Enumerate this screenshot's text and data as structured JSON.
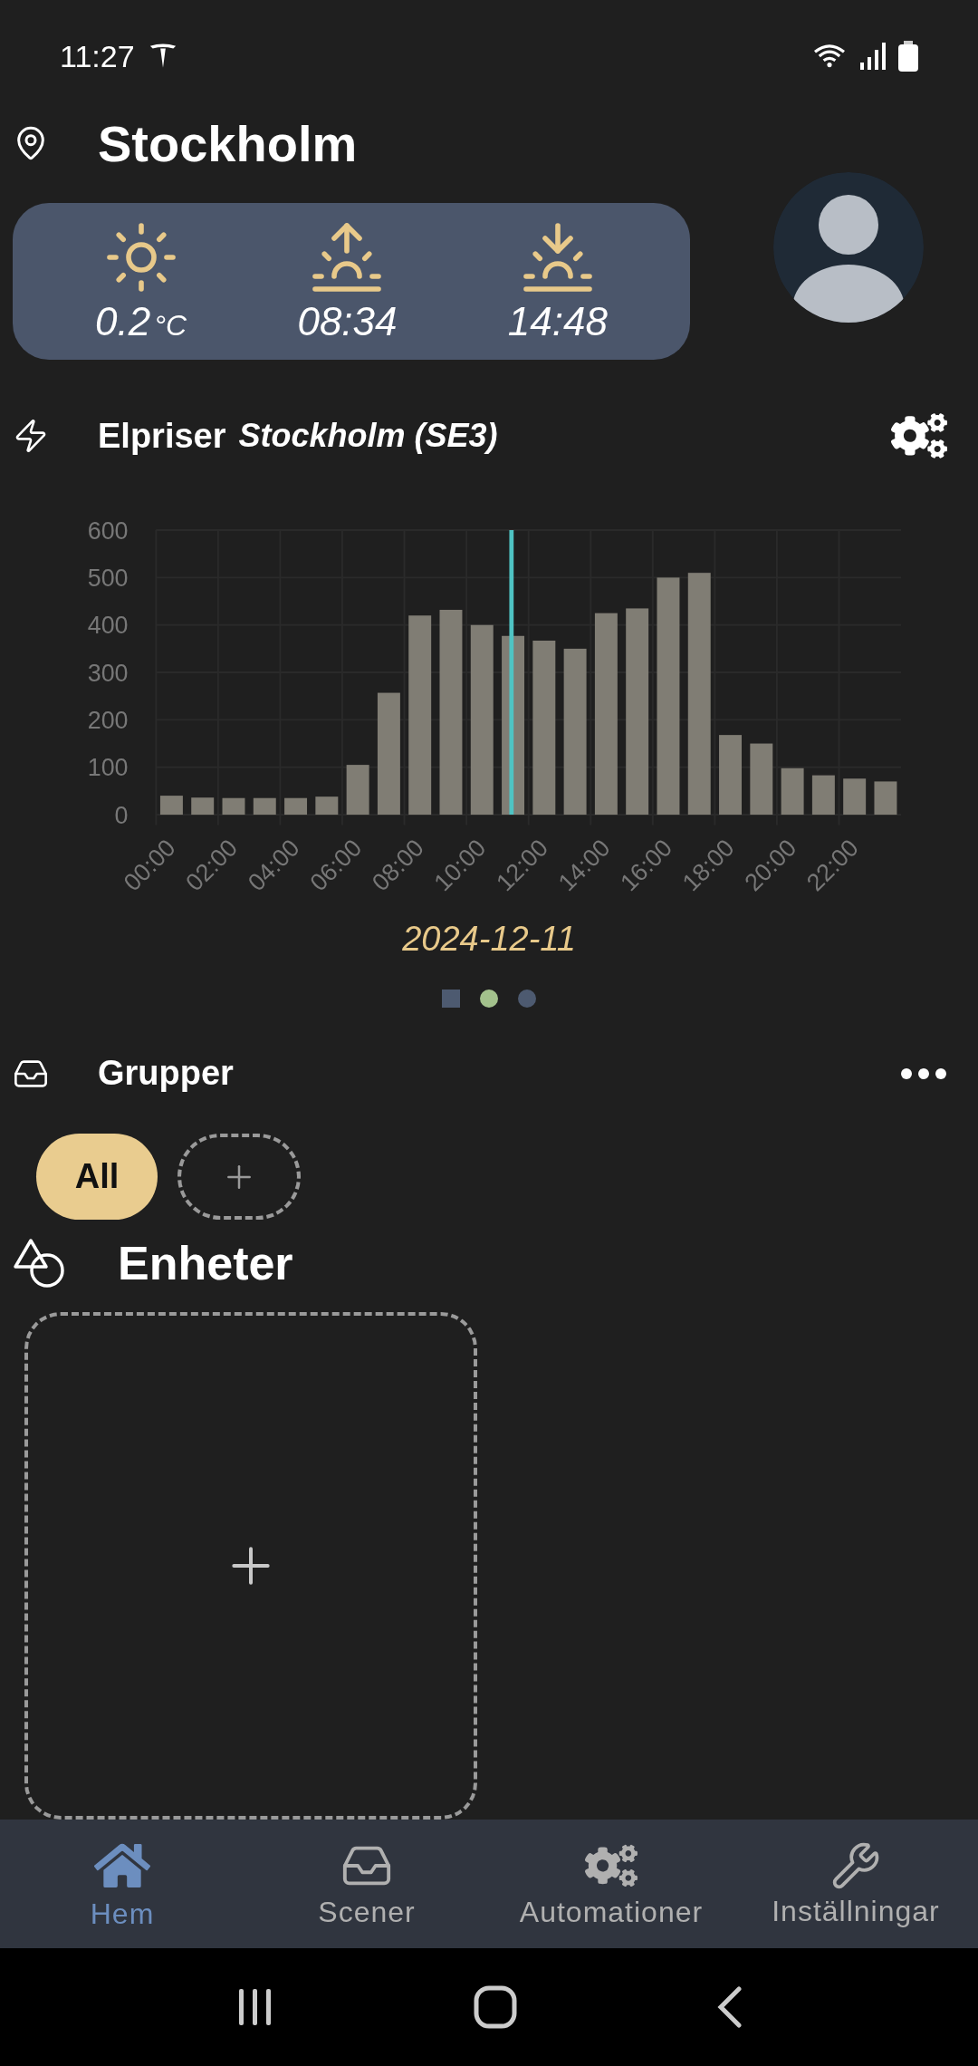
{
  "status_bar": {
    "time": "11:27"
  },
  "location": {
    "title": "Stockholm"
  },
  "weather": [
    {
      "kind": "temperature",
      "value": "0.2",
      "unit": "°C"
    },
    {
      "kind": "sunrise",
      "value": "08:34"
    },
    {
      "kind": "sunset",
      "value": "14:48"
    }
  ],
  "prices": {
    "title": "Elpriser",
    "region": "Stockholm (SE3)",
    "chart_data": {
      "type": "bar",
      "x": [
        0.5,
        1.5,
        2.5,
        3.5,
        4.5,
        5.5,
        6.5,
        7.5,
        8.5,
        9.5,
        10.5,
        11.5,
        12.5,
        13.5,
        14.5,
        15.5,
        16.5,
        17.5,
        18.5,
        19.5,
        20.5,
        21.5,
        22.5,
        23.5
      ],
      "xlim": [
        0,
        24
      ],
      "grid": true,
      "series": [
        {
          "color": "#807d74",
          "values": [
            40,
            36,
            35,
            35,
            35,
            38,
            105,
            257,
            420,
            432,
            400,
            377,
            367,
            350,
            425,
            435,
            500,
            510,
            168,
            150,
            98,
            83,
            76,
            70
          ]
        }
      ],
      "ylim": [
        0,
        600
      ],
      "yticks": [
        0,
        100,
        200,
        300,
        400,
        500,
        600
      ],
      "xticks": [
        {
          "value": 0,
          "label": "00:00"
        },
        {
          "value": 2,
          "label": "02:00"
        },
        {
          "value": 4,
          "label": "04:00"
        },
        {
          "value": 6,
          "label": "06:00"
        },
        {
          "value": 8,
          "label": "08:00"
        },
        {
          "value": 10,
          "label": "10:00"
        },
        {
          "value": 12,
          "label": "12:00"
        },
        {
          "value": 14,
          "label": "14:00"
        },
        {
          "value": 16,
          "label": "16:00"
        },
        {
          "value": 18,
          "label": "18:00"
        },
        {
          "value": 20,
          "label": "20:00"
        },
        {
          "value": 22,
          "label": "22:00"
        }
      ],
      "ref_lines": [
        {
          "axis": "x",
          "value": 11.45
        }
      ]
    },
    "date": "2024-12-11",
    "pages": [
      {
        "kind": "square",
        "color": "#4d5a70"
      },
      {
        "kind": "circle",
        "color": "#a3c18c"
      },
      {
        "kind": "circle",
        "color": "#4d5a70"
      }
    ]
  },
  "groups": {
    "title": "Grupper",
    "chips": [
      {
        "label": "All",
        "selected": true
      }
    ]
  },
  "devices": {
    "title": "Enheter"
  },
  "nav": [
    {
      "kind": "home",
      "label": "Hem",
      "selected": true
    },
    {
      "kind": "scenes",
      "label": "Scener",
      "selected": false
    },
    {
      "kind": "automations",
      "label": "Automationer",
      "selected": false
    },
    {
      "kind": "settings",
      "label": "Inställningar",
      "selected": false
    }
  ]
}
